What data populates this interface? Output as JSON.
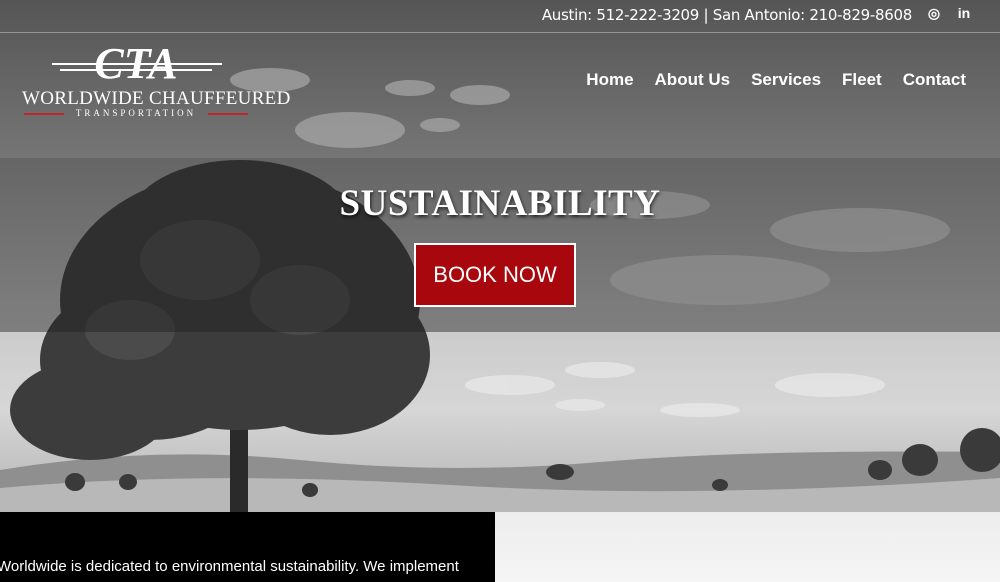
{
  "topbar": {
    "phones": "Austin: 512-222-3209 | San Antonio: 210-829-8608",
    "social": [
      {
        "icon": "instagram-icon",
        "glyph": "◎"
      },
      {
        "icon": "linkedin-icon",
        "glyph": "in"
      }
    ]
  },
  "logo": {
    "mark": "CTA",
    "wordmark": "WORLDWIDE CHAUFFEURED",
    "sub": "TRANSPORTATION",
    "accent": "#c0262d"
  },
  "nav": {
    "items": [
      "Home",
      "About Us",
      "Services",
      "Fleet",
      "Contact"
    ]
  },
  "hero": {
    "title": "SUSTAINABILITY",
    "cta": "BOOK NOW",
    "cta_color": "#a8070d"
  },
  "content": {
    "text": "Worldwide is dedicated to environmental sustainability. We implement"
  }
}
